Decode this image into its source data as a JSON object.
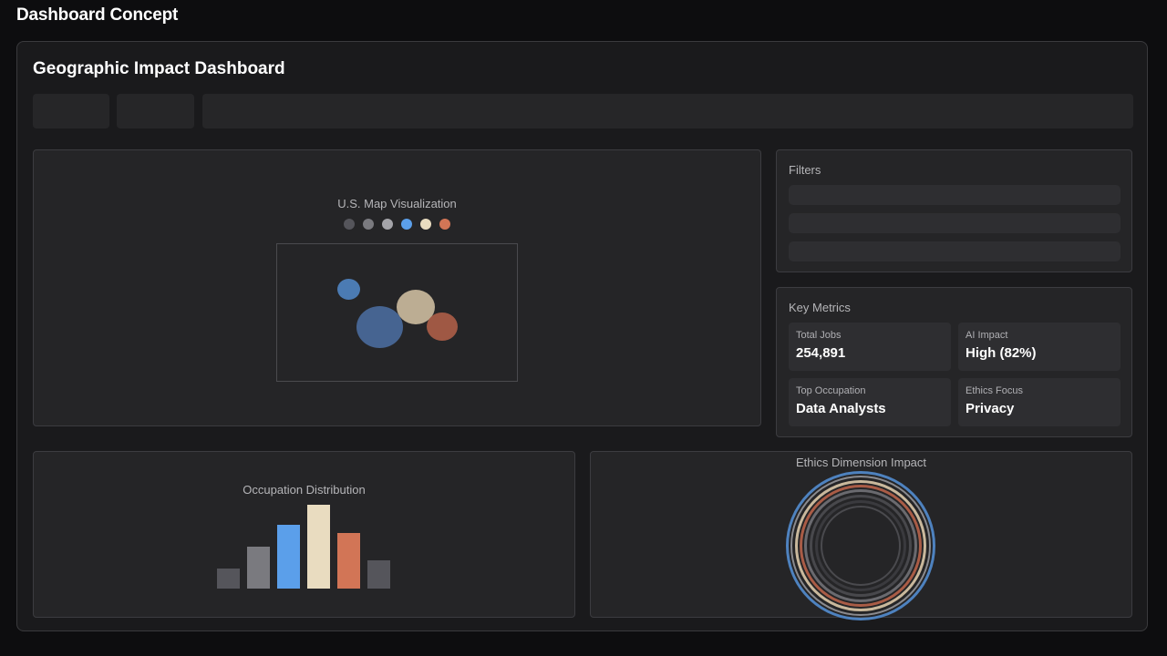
{
  "app": {
    "title": "Dashboard Concept"
  },
  "dashboard": {
    "title": "Geographic Impact Dashboard",
    "tabs": [
      "",
      "",
      ""
    ]
  },
  "map_panel": {
    "title": "U.S. Map Visualization",
    "legend_colors": [
      "#55555b",
      "#7a7a7f",
      "#a4a4a9",
      "#5b9fea",
      "#e9dcc0",
      "#d27556"
    ],
    "bubbles": [
      {
        "color": "#4e82bf"
      },
      {
        "color": "#49699a"
      },
      {
        "color": "#c9b89c"
      },
      {
        "color": "#a95c46"
      }
    ]
  },
  "filters": {
    "title": "Filters",
    "bars": [
      "",
      "",
      ""
    ]
  },
  "metrics": {
    "title": "Key Metrics",
    "total_jobs": {
      "label": "Total Jobs",
      "value": "254,891"
    },
    "ai_impact": {
      "label": "AI Impact",
      "value": "High (82%)"
    },
    "top_occupation": {
      "label": "Top Occupation",
      "value": "Data Analysts"
    },
    "ethics_focus": {
      "label": "Ethics Focus",
      "value": "Privacy"
    }
  },
  "occupation": {
    "title": "Occupation Distribution"
  },
  "ethics": {
    "title": "Ethics Dimension Impact"
  },
  "chart_data": [
    {
      "type": "bar",
      "title": "Occupation Distribution",
      "categories": [
        "",
        "",
        "",
        "",
        "",
        ""
      ],
      "values": [
        22,
        45,
        68,
        90,
        60,
        30
      ],
      "colors": [
        "#55555b",
        "#7a7a7f",
        "#5b9fea",
        "#e9dcc0",
        "#d27556",
        "#55555b"
      ],
      "ylim": [
        0,
        90
      ]
    },
    {
      "type": "pie",
      "title": "Ethics Dimension Impact",
      "ring_colors": [
        "#4e82bf",
        "#8a8a8e",
        "#c9b89c",
        "#a95c46",
        "#6a6a6f",
        "#48484c",
        "#3a3a3e",
        "#4a4a4e"
      ]
    }
  ]
}
